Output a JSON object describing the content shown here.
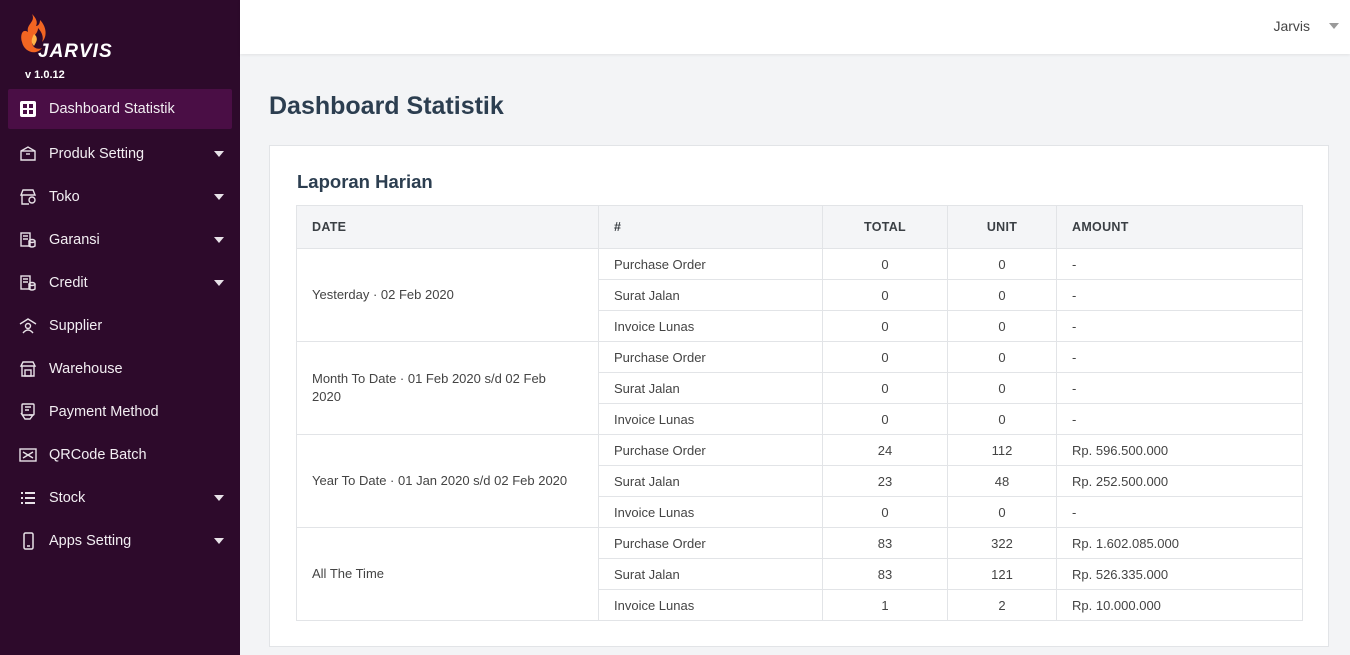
{
  "app": {
    "logo_text": "JARVIS",
    "version": "v 1.0.12"
  },
  "sidebar": {
    "items": [
      {
        "label": "Dashboard Statistik",
        "icon": "dashboard-icon",
        "has_caret": false,
        "active": true
      },
      {
        "label": "Produk Setting",
        "icon": "box-icon",
        "has_caret": true
      },
      {
        "label": "Toko",
        "icon": "store-icon",
        "has_caret": true
      },
      {
        "label": "Garansi",
        "icon": "warranty-icon",
        "has_caret": true
      },
      {
        "label": "Credit",
        "icon": "credit-icon",
        "has_caret": true
      },
      {
        "label": "Supplier",
        "icon": "supplier-icon",
        "has_caret": false
      },
      {
        "label": "Warehouse",
        "icon": "warehouse-icon",
        "has_caret": false
      },
      {
        "label": "Payment Method",
        "icon": "payment-icon",
        "has_caret": false
      },
      {
        "label": "QRCode Batch",
        "icon": "qrcode-icon",
        "has_caret": false
      },
      {
        "label": "Stock",
        "icon": "list-icon",
        "has_caret": true
      },
      {
        "label": "Apps Setting",
        "icon": "phone-icon",
        "has_caret": true
      }
    ]
  },
  "header": {
    "user": "Jarvis"
  },
  "page": {
    "title": "Dashboard Statistik"
  },
  "report": {
    "title": "Laporan Harian",
    "columns": {
      "date": "DATE",
      "type": "#",
      "total": "TOTAL",
      "unit": "UNIT",
      "amount": "AMOUNT"
    },
    "groups": [
      {
        "period": "Yesterday · 02 Feb 2020",
        "rows": [
          {
            "type": "Purchase Order",
            "total": "0",
            "unit": "0",
            "amount": "-"
          },
          {
            "type": "Surat Jalan",
            "total": "0",
            "unit": "0",
            "amount": "-"
          },
          {
            "type": "Invoice Lunas",
            "total": "0",
            "unit": "0",
            "amount": "-"
          }
        ]
      },
      {
        "period": "Month To Date · 01 Feb 2020 s/d 02 Feb 2020",
        "rows": [
          {
            "type": "Purchase Order",
            "total": "0",
            "unit": "0",
            "amount": "-"
          },
          {
            "type": "Surat Jalan",
            "total": "0",
            "unit": "0",
            "amount": "-"
          },
          {
            "type": "Invoice Lunas",
            "total": "0",
            "unit": "0",
            "amount": "-"
          }
        ]
      },
      {
        "period": "Year To Date · 01 Jan 2020 s/d 02 Feb 2020",
        "rows": [
          {
            "type": "Purchase Order",
            "total": "24",
            "unit": "112",
            "amount": "Rp. 596.500.000"
          },
          {
            "type": "Surat Jalan",
            "total": "23",
            "unit": "48",
            "amount": "Rp. 252.500.000"
          },
          {
            "type": "Invoice Lunas",
            "total": "0",
            "unit": "0",
            "amount": "-"
          }
        ]
      },
      {
        "period": "All The Time",
        "rows": [
          {
            "type": "Purchase Order",
            "total": "83",
            "unit": "322",
            "amount": "Rp. 1.602.085.000"
          },
          {
            "type": "Surat Jalan",
            "total": "83",
            "unit": "121",
            "amount": "Rp. 526.335.000"
          },
          {
            "type": "Invoice Lunas",
            "total": "1",
            "unit": "2",
            "amount": "Rp. 10.000.000"
          }
        ]
      }
    ]
  },
  "colors": {
    "sidebar_bg": "#2d0a2b",
    "sidebar_active": "#4a0e45",
    "logo_flame": "#f26522",
    "title": "#2c3e50"
  }
}
